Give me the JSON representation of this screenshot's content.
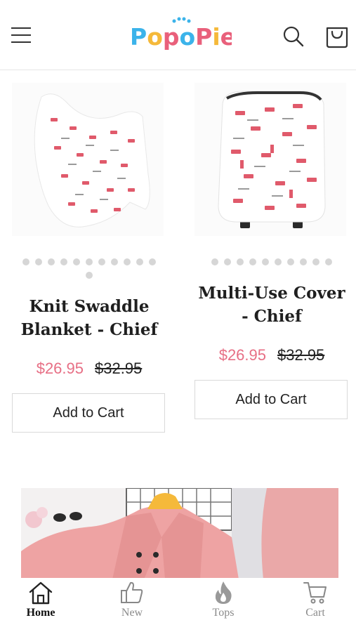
{
  "header": {
    "logo_text": "PopoPie",
    "colors": {
      "logo_p": "#3bb3ea",
      "logo_o1": "#f5b93a",
      "logo_p2": "#e9607b",
      "logo_o2": "#3bb3ea",
      "logo_p3": "#e9607b",
      "logo_i": "#f5b93a",
      "logo_e": "#e9607b"
    }
  },
  "products": [
    {
      "title": "Knit Swaddle Blanket - Chief",
      "sale_price": "$26.95",
      "compare_price": "$32.95",
      "button_label": "Add to Cart",
      "image_dots": 12
    },
    {
      "title": "Multi-Use Cover - Chief",
      "sale_price": "$26.95",
      "compare_price": "$32.95",
      "button_label": "Add to Cart",
      "image_dots": 10
    }
  ],
  "bottom_nav": {
    "items": [
      {
        "label": "Home",
        "icon": "home-icon",
        "active": true
      },
      {
        "label": "New",
        "icon": "thumbs-up-icon",
        "active": false
      },
      {
        "label": "Tops",
        "icon": "fire-icon",
        "active": false
      },
      {
        "label": "Cart",
        "icon": "cart-icon",
        "active": false
      }
    ]
  },
  "colors": {
    "accent": "#e76f85",
    "border": "#d9d9d9",
    "muted": "#8a8a8a"
  }
}
